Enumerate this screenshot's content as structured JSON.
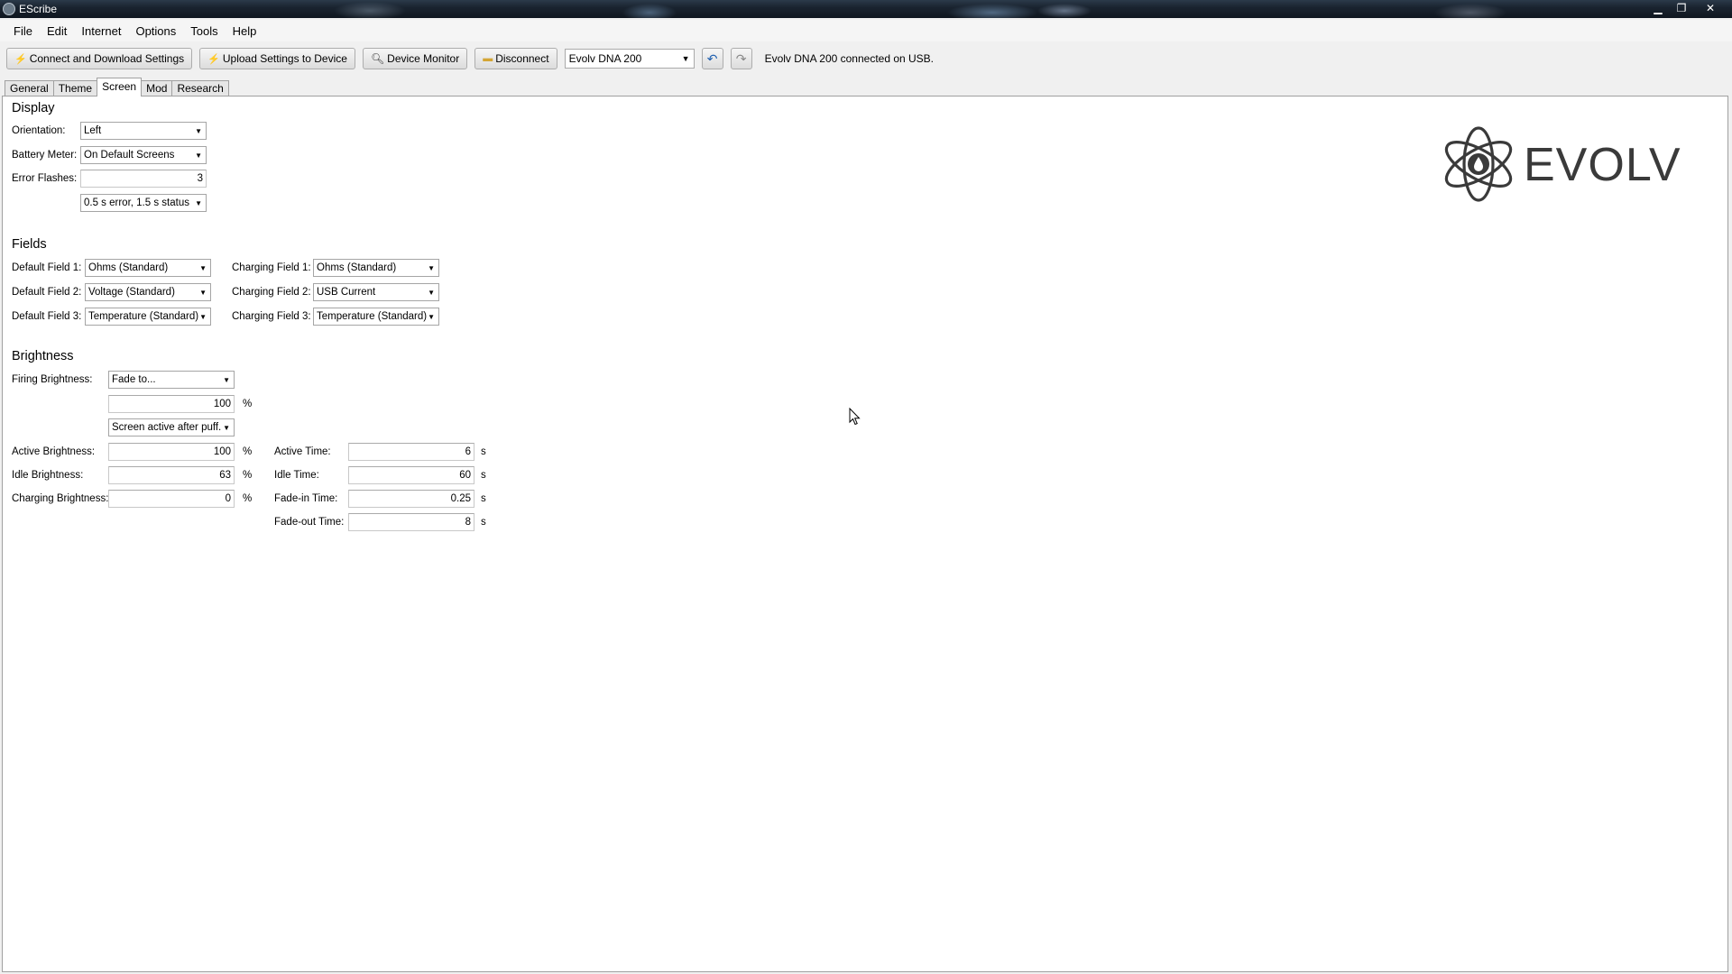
{
  "window": {
    "title": "EScribe",
    "minimize": "▁",
    "maximize": "❐",
    "close": "✕"
  },
  "menu": [
    "File",
    "Edit",
    "Internet",
    "Options",
    "Tools",
    "Help"
  ],
  "toolbar": {
    "connect_label": "Connect and Download Settings",
    "upload_label": "Upload Settings to Device",
    "monitor_label": "Device Monitor",
    "disconnect_label": "Disconnect",
    "device_value": "Evolv DNA 200",
    "status": "Evolv DNA 200 connected on USB."
  },
  "tabs": [
    "General",
    "Theme",
    "Screen",
    "Mod",
    "Research"
  ],
  "active_tab": "Screen",
  "display": {
    "title": "Display",
    "orientation_label": "Orientation:",
    "orientation_value": "Left",
    "battery_label": "Battery Meter:",
    "battery_value": "On Default Screens",
    "error_flashes_label": "Error Flashes:",
    "error_flashes_value": "3",
    "error_timing_value": "0.5 s error, 1.5 s status"
  },
  "fields": {
    "title": "Fields",
    "default": [
      {
        "label": "Default Field 1:",
        "value": "Ohms (Standard)"
      },
      {
        "label": "Default Field 2:",
        "value": "Voltage (Standard)"
      },
      {
        "label": "Default Field 3:",
        "value": "Temperature (Standard)"
      }
    ],
    "charging": [
      {
        "label": "Charging Field 1:",
        "value": "Ohms (Standard)"
      },
      {
        "label": "Charging Field 2:",
        "value": "USB Current"
      },
      {
        "label": "Charging Field 3:",
        "value": "Temperature (Standard)"
      }
    ]
  },
  "brightness": {
    "title": "Brightness",
    "firing_label": "Firing Brightness:",
    "firing_mode": "Fade to...",
    "firing_percent": "100",
    "screen_mode": "Screen active after puff.",
    "active_label": "Active Brightness:",
    "active_value": "100",
    "idle_label": "Idle Brightness:",
    "idle_value": "63",
    "charging_label": "Charging Brightness:",
    "charging_value": "0",
    "percent_unit": "%",
    "active_time_label": "Active Time:",
    "active_time_value": "6",
    "idle_time_label": "Idle Time:",
    "idle_time_value": "60",
    "fadein_label": "Fade-in Time:",
    "fadein_value": "0.25",
    "fadeout_label": "Fade-out Time:",
    "fadeout_value": "8",
    "seconds_unit": "s"
  },
  "logo": {
    "text": "EVOLV",
    "color": "#3a3a3a"
  }
}
